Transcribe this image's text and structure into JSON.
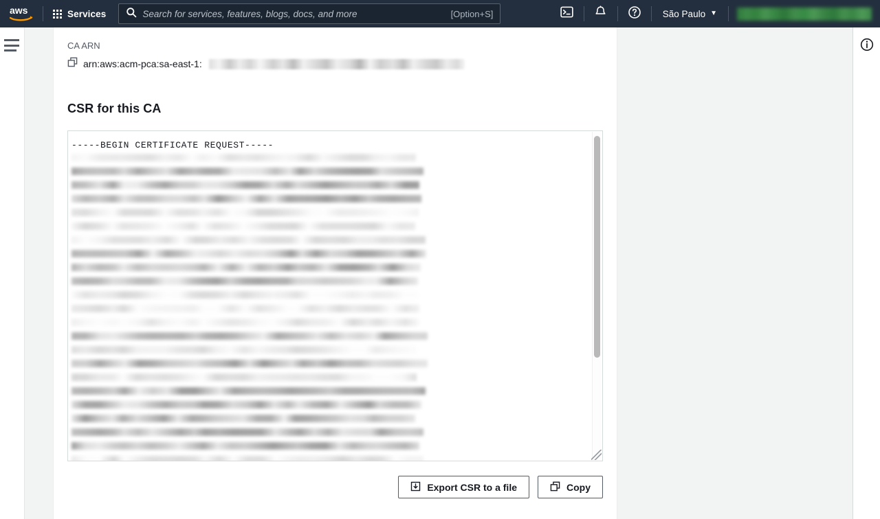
{
  "topnav": {
    "logo_alt": "aws",
    "services_label": "Services",
    "search": {
      "placeholder": "Search for services, features, blogs, docs, and more",
      "value": "",
      "shortcut_hint": "[Option+S]"
    },
    "cloudshell_icon": "cloudshell-icon",
    "notifications_icon": "bell-icon",
    "help_icon": "help-circle-icon",
    "region_label": "São Paulo",
    "region_caret": "▼",
    "account_label": ""
  },
  "sidebar": {
    "toggle_icon": "hamburger-icon"
  },
  "main": {
    "ca_arn": {
      "label": "CA ARN",
      "copy_icon": "copy-icon",
      "value_prefix": "arn:aws:acm-pca:sa-east-1:",
      "value_redacted": ""
    },
    "csr": {
      "title": "CSR for this CA",
      "begin_line": "-----BEGIN CERTIFICATE REQUEST-----",
      "body_redacted": "",
      "scrollbar": "vertical-scrollbar",
      "resize_handle": "resize-grip"
    },
    "actions": {
      "export_label": "Export CSR to a file",
      "export_icon": "download-icon",
      "copy_label": "Copy",
      "copy_icon": "copy-icon"
    }
  },
  "info_panel": {
    "icon": "info-circle-icon"
  },
  "colors": {
    "nav_bg": "#232f3e",
    "page_bg": "#f2f3f3",
    "card_bg": "#ffffff",
    "text": "#16191f",
    "muted_text": "#545b64",
    "border": "#d5dbdb",
    "account_accent": "#3a8c45"
  }
}
